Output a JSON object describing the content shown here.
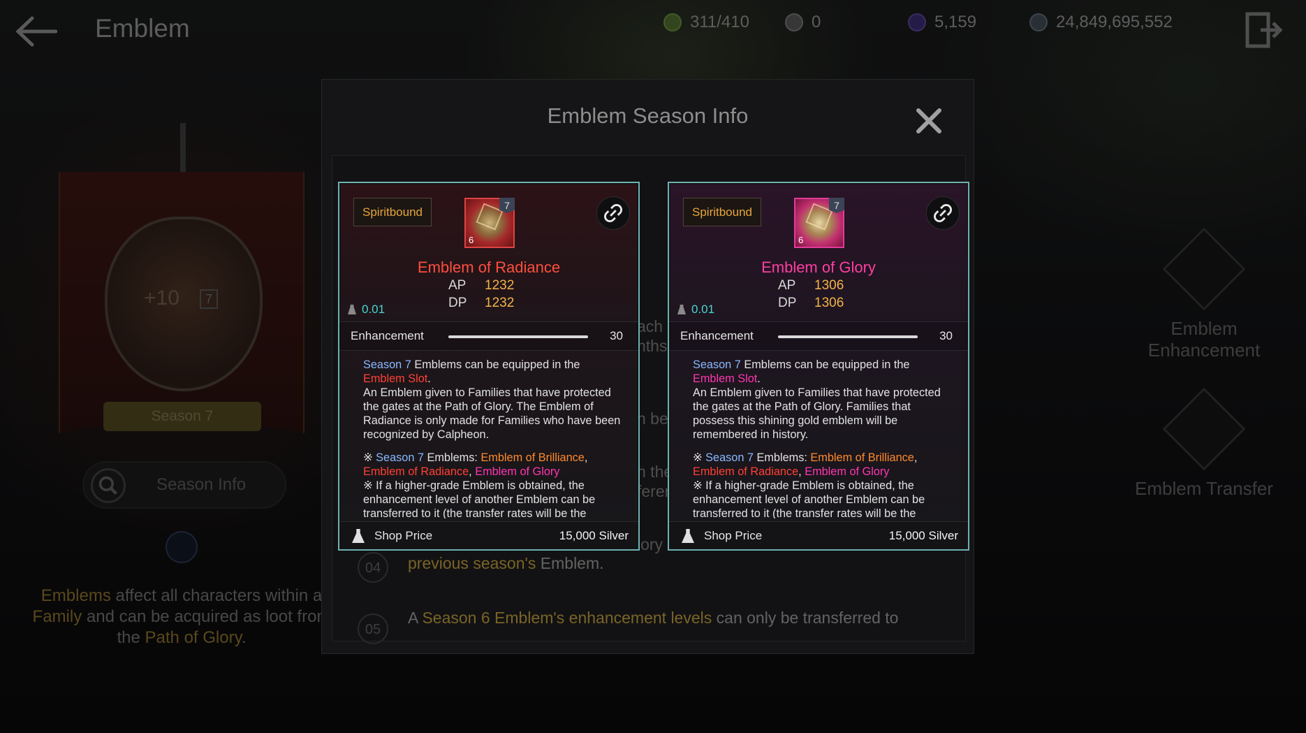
{
  "header": {
    "title": "Emblem",
    "currencies": [
      {
        "icon": "energy-icon",
        "value": "311/410",
        "color": "#5a7a3a"
      },
      {
        "icon": "black-stone-icon",
        "value": "0",
        "color": "#5a5a5a"
      },
      {
        "icon": "crystal-icon",
        "value": "5,159",
        "color": "#3c2b6e"
      },
      {
        "icon": "silver-coin-icon",
        "value": "24,849,695,552",
        "color": "#4a5560"
      }
    ]
  },
  "left_panel": {
    "crest_level": "+10",
    "crest_grade": "7",
    "season_label": "Season 7",
    "season_info_button": "Season Info",
    "description": {
      "part1": "Emblems",
      "part2": " affect all characters within a",
      "part3": "Family",
      "part4": " and can be acquired as loot from",
      "part5": "the ",
      "part6": "Path of Glory",
      "part7": "."
    }
  },
  "right_menu": {
    "enhancement": "Emblem Enhancement",
    "transfer": "Emblem Transfer"
  },
  "modal": {
    "title": "Emblem Season Info",
    "notes": [
      {
        "num": "04",
        "hl1": "previous season's",
        "text": " Emblem."
      },
      {
        "num": "05",
        "prefix": "A ",
        "hl1": "Season 6 Emblem's enhancement levels",
        "text": " can only be transferred to"
      }
    ],
    "mid_fragments": [
      "ach",
      "nths",
      "n be",
      "n the",
      "feren",
      "lory"
    ]
  },
  "cards": [
    {
      "bind_label": "Spiritbound",
      "grade": "7",
      "lock_level": "6",
      "name": "Emblem of Radiance",
      "ap_label": "AP",
      "ap": "1232",
      "dp_label": "DP",
      "dp": "1232",
      "weight": "0.01",
      "enh_label": "Enhancement",
      "enh_value": "30",
      "enh_progress": 1.0,
      "desc": {
        "season": "Season 7",
        "equip": " Emblems can be equipped in the ",
        "slot": "Emblem Slot",
        "dot": ".",
        "lore": "An Emblem given to Families that have protected the gates at the Path of Glory. The Emblem of Radiance is only made for Families who have been recognized by Calpheon.",
        "note_mark": "※ ",
        "note_season": "Season 7",
        "note_emblems": " Emblems: ",
        "brilliance": "Emblem of Brilliance",
        "comma": ",",
        "radiance": "Emblem of Radiance",
        "comma2": ", ",
        "glory": "Emblem of Glory",
        "note2": "※ If a higher-grade Emblem is obtained, the enhancement level of another Emblem can be transferred to it (the transfer rates will be the"
      },
      "shop_label": "Shop Price",
      "shop_value": "15,000 Silver"
    },
    {
      "bind_label": "Spiritbound",
      "grade": "7",
      "lock_level": "6",
      "name": "Emblem of Glory",
      "ap_label": "AP",
      "ap": "1306",
      "dp_label": "DP",
      "dp": "1306",
      "weight": "0.01",
      "enh_label": "Enhancement",
      "enh_value": "30",
      "enh_progress": 1.0,
      "desc": {
        "season": "Season 7",
        "equip": " Emblems can be equipped in the ",
        "slot": "Emblem Slot",
        "dot": ".",
        "lore": "An Emblem given to Families that have protected the gates at the Path of Glory. Families that possess this shining gold emblem will be remembered in history.",
        "note_mark": "※ ",
        "note_season": "Season 7",
        "note_emblems": " Emblems: ",
        "brilliance": "Emblem of Brilliance",
        "comma": ",",
        "radiance": "Emblem of Radiance",
        "comma2": ", ",
        "glory": "Emblem of Glory",
        "note2": "※ If a higher-grade Emblem is obtained, the enhancement level of another Emblem can be transferred to it (the transfer rates will be the"
      },
      "shop_label": "Shop Price",
      "shop_value": "15,000 Silver"
    }
  ]
}
